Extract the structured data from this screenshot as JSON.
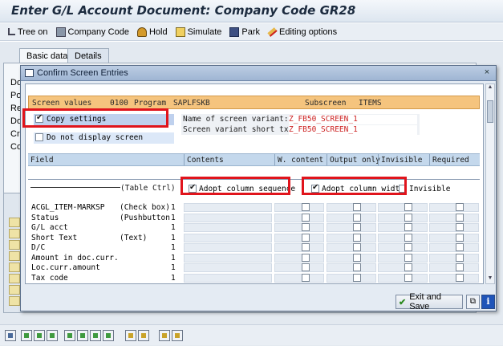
{
  "window": {
    "title": "Enter G/L Account Document: Company Code GR28"
  },
  "toolbar": {
    "tree_on": "Tree on",
    "company_code": "Company Code",
    "hold": "Hold",
    "simulate": "Simulate",
    "park": "Park",
    "editing_options": "Editing options"
  },
  "main": {
    "tabs": [
      "Basic data",
      "Details"
    ],
    "side_labels": [
      "Doc",
      "Pos",
      "Re",
      "Do",
      "Cro",
      "Con"
    ]
  },
  "dialog": {
    "title": "Confirm Screen Entries",
    "close_glyph": "×",
    "header": {
      "label": "Screen values",
      "program_number": "0100",
      "program_label": "Program",
      "program_name": "SAPLFSKB",
      "subscreen_label": "Subscreen",
      "subscreen_name": "ITEMS"
    },
    "copy_settings": {
      "label": "Copy settings",
      "checked": true
    },
    "do_not_display": {
      "label": "Do not display screen",
      "checked": false
    },
    "variant": {
      "name_label": "Name of screen variant:",
      "name_value": "Z_FB50_SCREEN_1",
      "short_label": "Screen variant short txt",
      "short_value": "Z_FB50_SCREEN_1"
    },
    "columns": [
      "Field",
      "Contents",
      "W. content",
      "Output only",
      "Invisible",
      "Required"
    ],
    "table_ctrl_label": "(Table Ctrl)",
    "adopt_column_sequence": {
      "label": "Adopt column sequence",
      "checked": true
    },
    "adopt_column_width": {
      "label": "Adopt column width",
      "checked": true
    },
    "invisible_all": {
      "label": "Invisible",
      "checked": false
    },
    "rows": [
      {
        "field": "ACGL_ITEM-MARKSP",
        "type": "(Check box)",
        "num": "1"
      },
      {
        "field": "Status",
        "type": "(Pushbutton",
        "num": "1"
      },
      {
        "field": "G/L acct",
        "type": "",
        "num": "1"
      },
      {
        "field": "Short Text",
        "type": "(Text)",
        "num": "1"
      },
      {
        "field": "D/C",
        "type": "",
        "num": "1"
      },
      {
        "field": "Amount in doc.curr.",
        "type": "",
        "num": "1"
      },
      {
        "field": "Loc.curr.amount",
        "type": "",
        "num": "1"
      },
      {
        "field": "Tax code",
        "type": "",
        "num": "1"
      }
    ],
    "exit_and_save": "Exit and Save",
    "ok_glyph": "✔",
    "info_glyph": "i"
  },
  "colors": {
    "highlight_red": "#e0141c",
    "header_orange": "#f5c47e",
    "variant_red": "#cc2222"
  },
  "icons": [
    "tree-icon",
    "company-code-icon",
    "hold-icon",
    "simulate-icon",
    "park-icon",
    "editing-options-icon",
    "dialog-icon",
    "close-icon",
    "ok-check-icon",
    "copy-icon",
    "info-icon"
  ]
}
